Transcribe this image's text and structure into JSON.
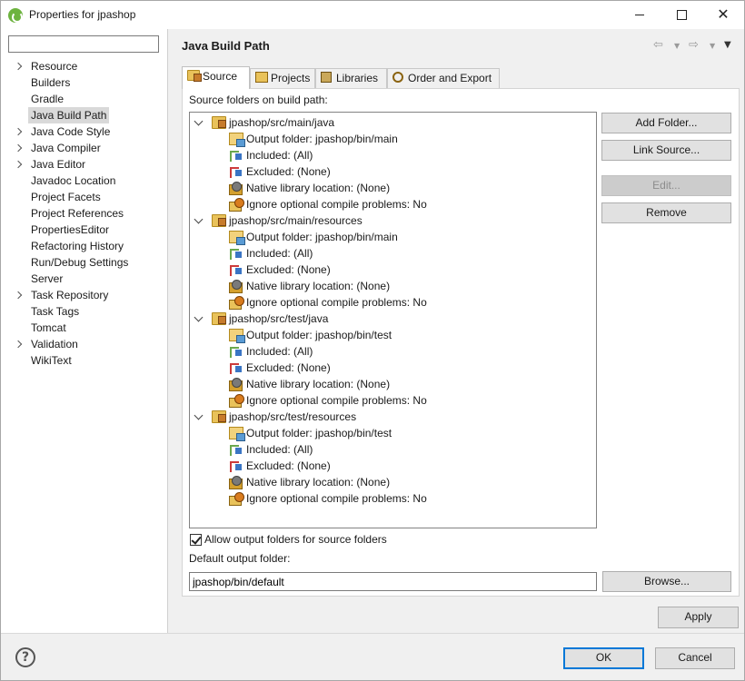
{
  "window": {
    "title": "Properties for jpashop"
  },
  "nav": {
    "filter_value": "",
    "items": [
      {
        "label": "Resource",
        "expandable": true,
        "selected": false
      },
      {
        "label": "Builders",
        "expandable": false,
        "selected": false
      },
      {
        "label": "Gradle",
        "expandable": false,
        "selected": false
      },
      {
        "label": "Java Build Path",
        "expandable": false,
        "selected": true
      },
      {
        "label": "Java Code Style",
        "expandable": true,
        "selected": false
      },
      {
        "label": "Java Compiler",
        "expandable": true,
        "selected": false
      },
      {
        "label": "Java Editor",
        "expandable": true,
        "selected": false
      },
      {
        "label": "Javadoc Location",
        "expandable": false,
        "selected": false
      },
      {
        "label": "Project Facets",
        "expandable": false,
        "selected": false
      },
      {
        "label": "Project References",
        "expandable": false,
        "selected": false
      },
      {
        "label": "PropertiesEditor",
        "expandable": false,
        "selected": false
      },
      {
        "label": "Refactoring History",
        "expandable": false,
        "selected": false
      },
      {
        "label": "Run/Debug Settings",
        "expandable": false,
        "selected": false
      },
      {
        "label": "Server",
        "expandable": false,
        "selected": false
      },
      {
        "label": "Task Repository",
        "expandable": true,
        "selected": false
      },
      {
        "label": "Task Tags",
        "expandable": false,
        "selected": false
      },
      {
        "label": "Tomcat",
        "expandable": false,
        "selected": false
      },
      {
        "label": "Validation",
        "expandable": true,
        "selected": false
      },
      {
        "label": "WikiText",
        "expandable": false,
        "selected": false
      }
    ]
  },
  "page": {
    "title": "Java Build Path"
  },
  "tabs": [
    {
      "label": "Source",
      "active": true
    },
    {
      "label": "Projects",
      "active": false
    },
    {
      "label": "Libraries",
      "active": false
    },
    {
      "label": "Order and Export",
      "active": false
    }
  ],
  "source": {
    "heading": "Source folders on build path:",
    "folders": [
      {
        "name": "jpashop/src/main/java",
        "children": [
          {
            "icon": "output-folder-icon",
            "text": "Output folder: jpashop/bin/main"
          },
          {
            "icon": "inclusion-filter-icon",
            "text": "Included: (All)"
          },
          {
            "icon": "exclusion-filter-icon",
            "text": "Excluded: (None)"
          },
          {
            "icon": "native-library-icon",
            "text": "Native library location: (None)"
          },
          {
            "icon": "ignore-problems-icon",
            "text": "Ignore optional compile problems: No"
          }
        ]
      },
      {
        "name": "jpashop/src/main/resources",
        "children": [
          {
            "icon": "output-folder-icon",
            "text": "Output folder: jpashop/bin/main"
          },
          {
            "icon": "inclusion-filter-icon",
            "text": "Included: (All)"
          },
          {
            "icon": "exclusion-filter-icon",
            "text": "Excluded: (None)"
          },
          {
            "icon": "native-library-icon",
            "text": "Native library location: (None)"
          },
          {
            "icon": "ignore-problems-icon",
            "text": "Ignore optional compile problems: No"
          }
        ]
      },
      {
        "name": "jpashop/src/test/java",
        "children": [
          {
            "icon": "output-folder-icon",
            "text": "Output folder: jpashop/bin/test"
          },
          {
            "icon": "inclusion-filter-icon",
            "text": "Included: (All)"
          },
          {
            "icon": "exclusion-filter-icon",
            "text": "Excluded: (None)"
          },
          {
            "icon": "native-library-icon",
            "text": "Native library location: (None)"
          },
          {
            "icon": "ignore-problems-icon",
            "text": "Ignore optional compile problems: No"
          }
        ]
      },
      {
        "name": "jpashop/src/test/resources",
        "children": [
          {
            "icon": "output-folder-icon",
            "text": "Output folder: jpashop/bin/test"
          },
          {
            "icon": "inclusion-filter-icon",
            "text": "Included: (All)"
          },
          {
            "icon": "exclusion-filter-icon",
            "text": "Excluded: (None)"
          },
          {
            "icon": "native-library-icon",
            "text": "Native library location: (None)"
          },
          {
            "icon": "ignore-problems-icon",
            "text": "Ignore optional compile problems: No"
          }
        ]
      }
    ],
    "buttons": {
      "add_folder": "Add Folder...",
      "link_source": "Link Source...",
      "edit": "Edit...",
      "remove": "Remove"
    },
    "allow_output_folders": {
      "label": "Allow output folders for source folders",
      "checked": true
    },
    "default_output": {
      "label": "Default output folder:",
      "value": "jpashop/bin/default",
      "browse": "Browse..."
    }
  },
  "footer": {
    "apply": "Apply",
    "ok": "OK",
    "cancel": "Cancel"
  },
  "colors": {
    "accent": "#0078d7",
    "selection": "#d9d9d9",
    "spring_green": "#6db33f"
  }
}
